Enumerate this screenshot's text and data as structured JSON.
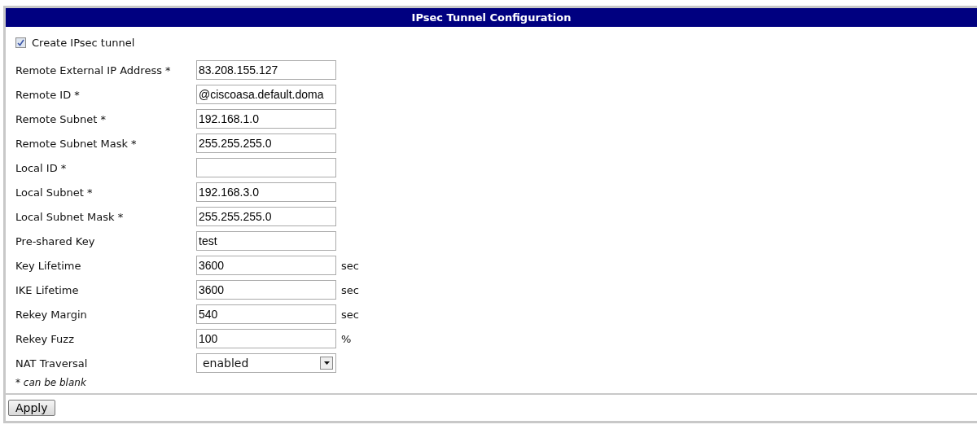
{
  "panel": {
    "title": "IPsec Tunnel Configuration"
  },
  "create_tunnel": {
    "label": "Create IPsec tunnel",
    "checked": true
  },
  "fields": [
    {
      "kind": "text",
      "label": "Remote External IP Address *",
      "value": "83.208.155.127"
    },
    {
      "kind": "text",
      "label": "Remote ID *",
      "value": "@ciscoasa.default.doma"
    },
    {
      "kind": "text",
      "label": "Remote Subnet *",
      "value": "192.168.1.0"
    },
    {
      "kind": "text",
      "label": "Remote Subnet Mask *",
      "value": "255.255.255.0"
    },
    {
      "kind": "text",
      "label": "Local ID *"
    },
    {
      "kind": "text",
      "label": "Local Subnet *",
      "value": "192.168.3.0"
    },
    {
      "kind": "text",
      "label": "Local Subnet Mask *",
      "value": "255.255.255.0"
    },
    {
      "kind": "text",
      "label": "Pre-shared Key",
      "value": "test"
    },
    {
      "kind": "text",
      "label": "Key Lifetime",
      "value": "3600",
      "unit": "sec"
    },
    {
      "kind": "text",
      "label": "IKE Lifetime",
      "value": "3600",
      "unit": "sec"
    },
    {
      "kind": "text",
      "label": "Rekey Margin",
      "value": "540",
      "unit": "sec"
    },
    {
      "kind": "text",
      "label": "Rekey Fuzz",
      "value": "100",
      "unit": "%"
    },
    {
      "kind": "select",
      "label": "NAT Traversal",
      "value": "enabled"
    }
  ],
  "note": "* can be blank",
  "buttons": [
    "Apply"
  ]
}
